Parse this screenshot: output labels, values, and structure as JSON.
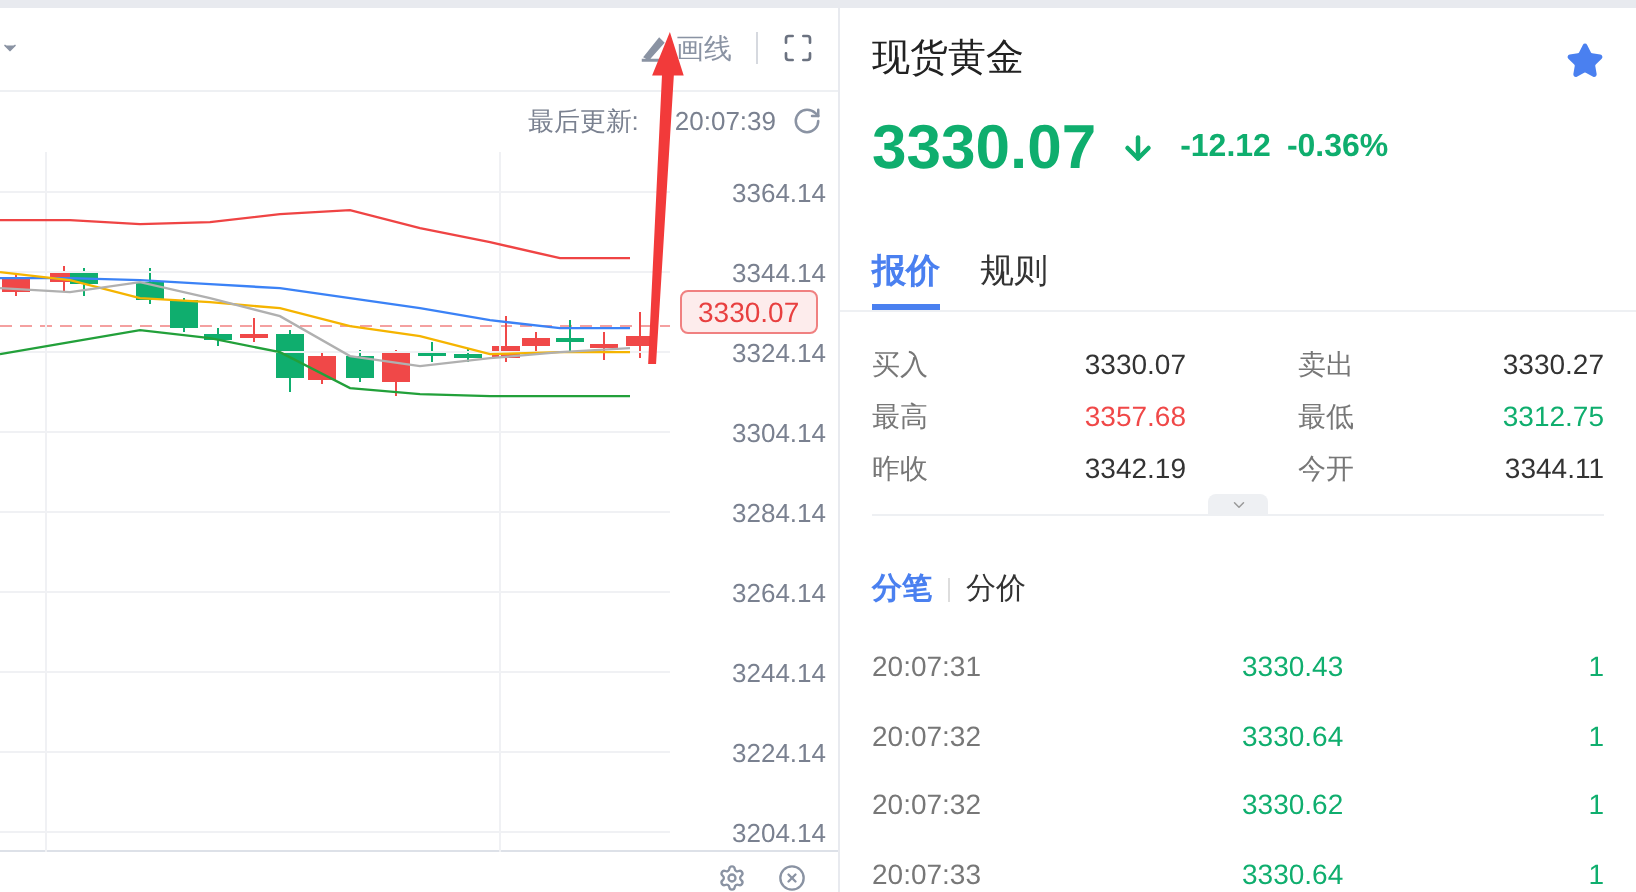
{
  "toolbar": {
    "draw_label": "画线",
    "last_update_label": "最后更新:",
    "last_update_time": "20:07:39"
  },
  "chart": {
    "price_tag": "3330.07",
    "chart_data": {
      "type": "line",
      "ylim": [
        3199.14,
        3374.14
      ],
      "grid": true,
      "yticks": [
        {
          "value": 3364.14,
          "label": "3364.14"
        },
        {
          "value": 3344.14,
          "label": "3344.14"
        },
        {
          "value": 3324.14,
          "label": "3324.14"
        },
        {
          "value": 3304.14,
          "label": "3304.14"
        },
        {
          "value": 3284.14,
          "label": "3284.14"
        },
        {
          "value": 3264.14,
          "label": "3264.14"
        },
        {
          "value": 3244.14,
          "label": "3244.14"
        },
        {
          "value": 3224.14,
          "label": "3224.14"
        },
        {
          "value": 3204.14,
          "label": "3204.14"
        }
      ],
      "series": [
        {
          "color": "#ef4444",
          "values": [
            3357.1,
            3357.1,
            3356.1,
            3356.6,
            3358.6,
            3359.6,
            3355.1,
            3351.6,
            3347.6,
            3347.6
          ]
        },
        {
          "color": "#3b82f6",
          "values": [
            3342.6,
            3342.6,
            3342.1,
            3341.1,
            3340.1,
            3337.6,
            3335.1,
            3332.1,
            3330.1,
            3330.1
          ]
        },
        {
          "color": "#f5b400",
          "values": [
            3344.1,
            3342.1,
            3337.6,
            3336.6,
            3335.1,
            3330.6,
            3328.1,
            3323.6,
            3324.1,
            3324.1
          ]
        },
        {
          "color": "#b0b0b0",
          "values": [
            3340.1,
            3339.1,
            3341.6,
            3337.6,
            3333.1,
            3323.1,
            3320.6,
            3322.6,
            3324.1,
            3325.1
          ]
        },
        {
          "color": "#22a03a",
          "values": [
            3323.6,
            3326.6,
            3329.6,
            3327.6,
            3324.1,
            3315.1,
            3313.6,
            3313.1,
            3313.1,
            3313.1
          ]
        }
      ]
    }
  },
  "instrument": {
    "name": "现货黄金",
    "favorite": true,
    "price": "3330.07",
    "change": "-12.12",
    "change_percent": "-0.36%"
  },
  "tabs": [
    {
      "label": "报价",
      "selected": true
    },
    {
      "label": "规则",
      "selected": false
    }
  ],
  "quotes": [
    {
      "label": "买入",
      "value": "3330.07",
      "color": "#333333"
    },
    {
      "label": "卖出",
      "value": "3330.27",
      "color": "#333333"
    },
    {
      "label": "最高",
      "value": "3357.68",
      "color": "#f04848"
    },
    {
      "label": "最低",
      "value": "3312.75",
      "color": "#0fae6e"
    },
    {
      "label": "昨收",
      "value": "3342.19",
      "color": "#333333"
    },
    {
      "label": "今开",
      "value": "3344.11",
      "color": "#333333"
    }
  ],
  "trade_tabs": [
    {
      "label": "分笔",
      "selected": true
    },
    {
      "label": "分价",
      "selected": false
    }
  ],
  "trades": [
    {
      "time": "20:07:31",
      "price": "3330.43",
      "volume": "1",
      "color": "#0fae6e"
    },
    {
      "time": "20:07:32",
      "price": "3330.64",
      "volume": "1",
      "color": "#0fae6e"
    },
    {
      "time": "20:07:32",
      "price": "3330.62",
      "volume": "1",
      "color": "#0fae6e"
    },
    {
      "time": "20:07:33",
      "price": "3330.64",
      "volume": "1",
      "color": "#0fae6e"
    }
  ]
}
